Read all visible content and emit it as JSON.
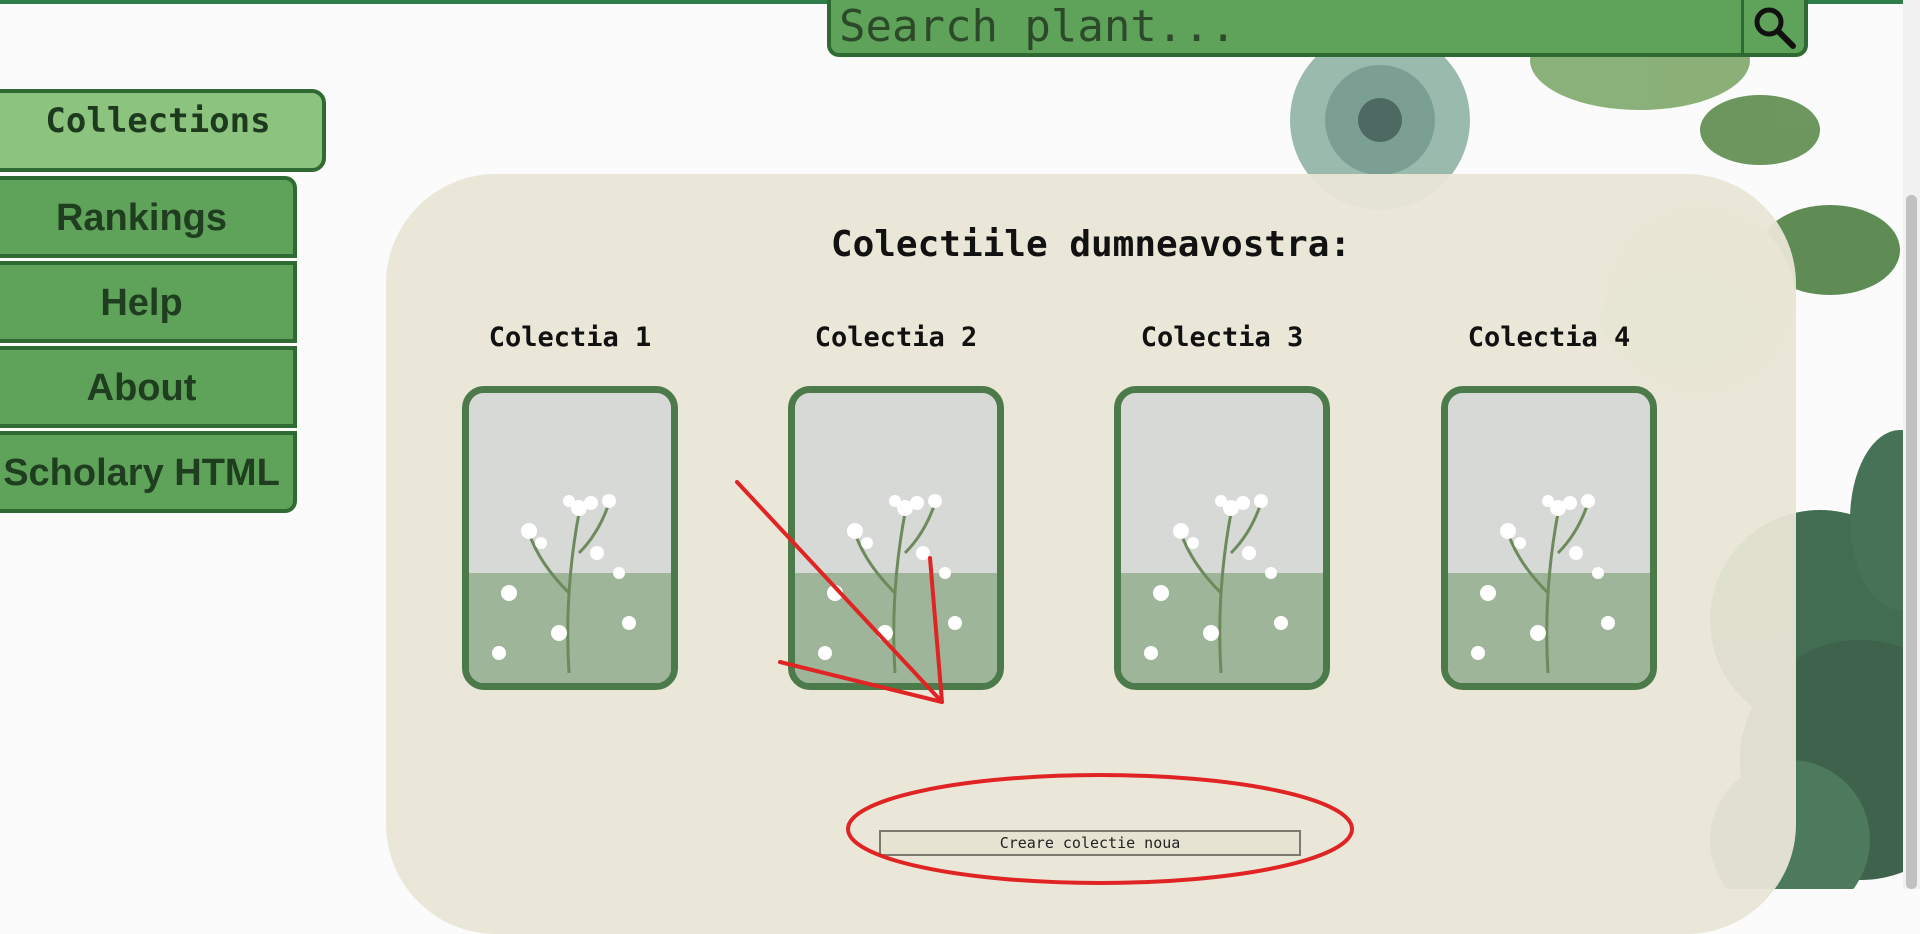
{
  "search": {
    "placeholder": "Search plant..."
  },
  "sidebar": {
    "active": "Collections",
    "items": [
      {
        "label": "Rankings"
      },
      {
        "label": "Help"
      },
      {
        "label": "About"
      },
      {
        "label": "Scholary HTML"
      }
    ]
  },
  "panel": {
    "title": "Colectiile dumneavostra:",
    "collections": [
      {
        "label": "Colectia 1"
      },
      {
        "label": "Colectia 2"
      },
      {
        "label": "Colectia 3"
      },
      {
        "label": "Colectia 4"
      }
    ],
    "create_button": "Creare colectie noua"
  },
  "colors": {
    "accent_green": "#5fa35a",
    "dark_green": "#2f6a33",
    "panel_bg": "#e9e6d6",
    "annotation_red": "#e02424"
  }
}
